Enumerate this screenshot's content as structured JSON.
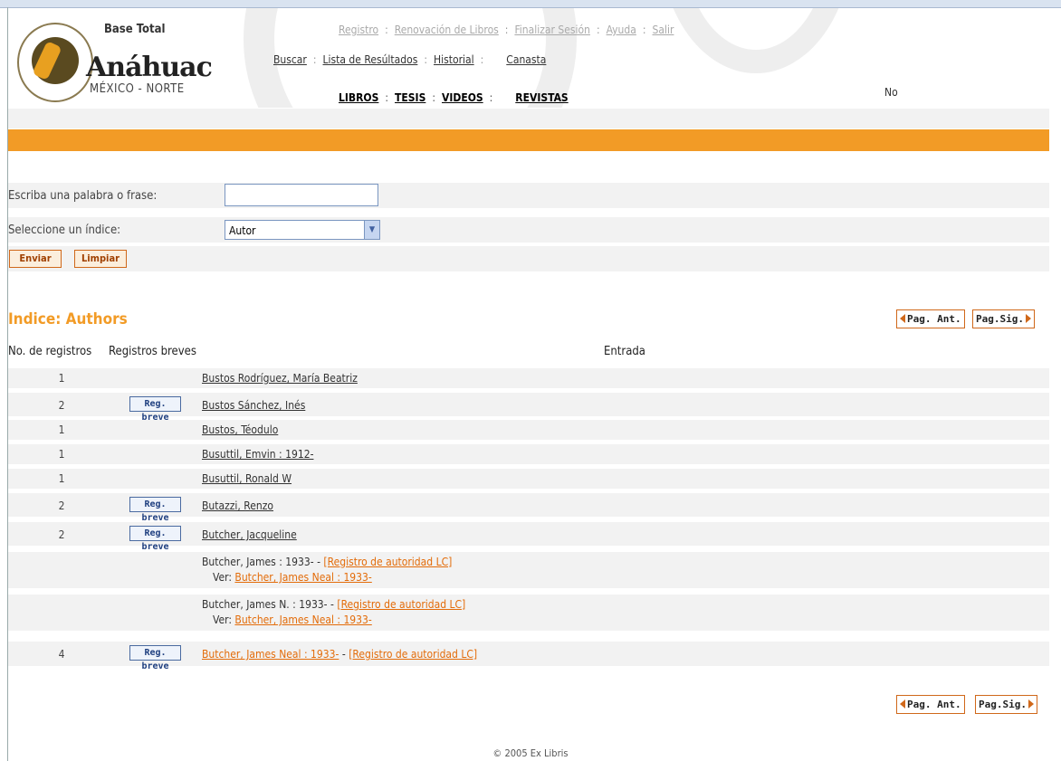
{
  "header": {
    "base_label": "Base Total",
    "logo_name": "Anáhuac",
    "logo_sub": "MÉXICO - NORTE",
    "nav_top": [
      "Registro",
      "Renovación de Libros",
      "Finalizar Sesión",
      "Ayuda",
      "Salir"
    ],
    "nav_mid": [
      "Buscar",
      "Lista de Resúltados",
      "Historial",
      "Canasta"
    ],
    "nav_bottom": [
      "LIBROS",
      "TESIS",
      "VIDEOS",
      "REVISTAS"
    ],
    "right_text": "No"
  },
  "search": {
    "phrase_label": "Escriba una palabra o frase:",
    "phrase_value": "",
    "index_label": "Seleccione un índice:",
    "index_value": "Autor",
    "submit_label": "Enviar",
    "clear_label": "Limpiar"
  },
  "index": {
    "title": "Indice: Authors",
    "prev_label": "Pag. Ant.",
    "next_label": "Pag.Sig.",
    "col_count": "No. de registros",
    "col_brief": "Registros breves",
    "col_entry": "Entrada",
    "reg_breve_label": "Reg. breve",
    "sep": "-",
    "rows": [
      {
        "count": "1",
        "brief": false,
        "entry": "Bustos Rodríguez, María Beatriz"
      },
      {
        "count": "2",
        "brief": true,
        "entry": "Bustos Sánchez, Inés"
      },
      {
        "count": "1",
        "brief": false,
        "entry": "Bustos, Téodulo"
      },
      {
        "count": "1",
        "brief": false,
        "entry": "Busuttil, Emvin : 1912-"
      },
      {
        "count": "1",
        "brief": false,
        "entry": "Busuttil, Ronald W"
      },
      {
        "count": "2",
        "brief": true,
        "entry": "Butazzi, Renzo"
      },
      {
        "count": "2",
        "brief": true,
        "entry": "Butcher, Jacqueline"
      },
      {
        "count": "",
        "brief": false,
        "entry_plain": "Butcher, James : 1933-",
        "authority": "[Registro de autoridad LC]",
        "see_label": "Ver:",
        "see_link": "Butcher, James Neal : 1933-"
      },
      {
        "count": "",
        "brief": false,
        "entry_plain": "Butcher, James N. : 1933-",
        "authority": "[Registro de autoridad LC]",
        "see_label": "Ver:",
        "see_link": "Butcher, James Neal : 1933-"
      },
      {
        "count": "4",
        "brief": true,
        "entry": "Butcher, James Neal : 1933-",
        "authority": "[Registro de autoridad LC]"
      }
    ]
  },
  "footer": "© 2005 Ex Libris"
}
